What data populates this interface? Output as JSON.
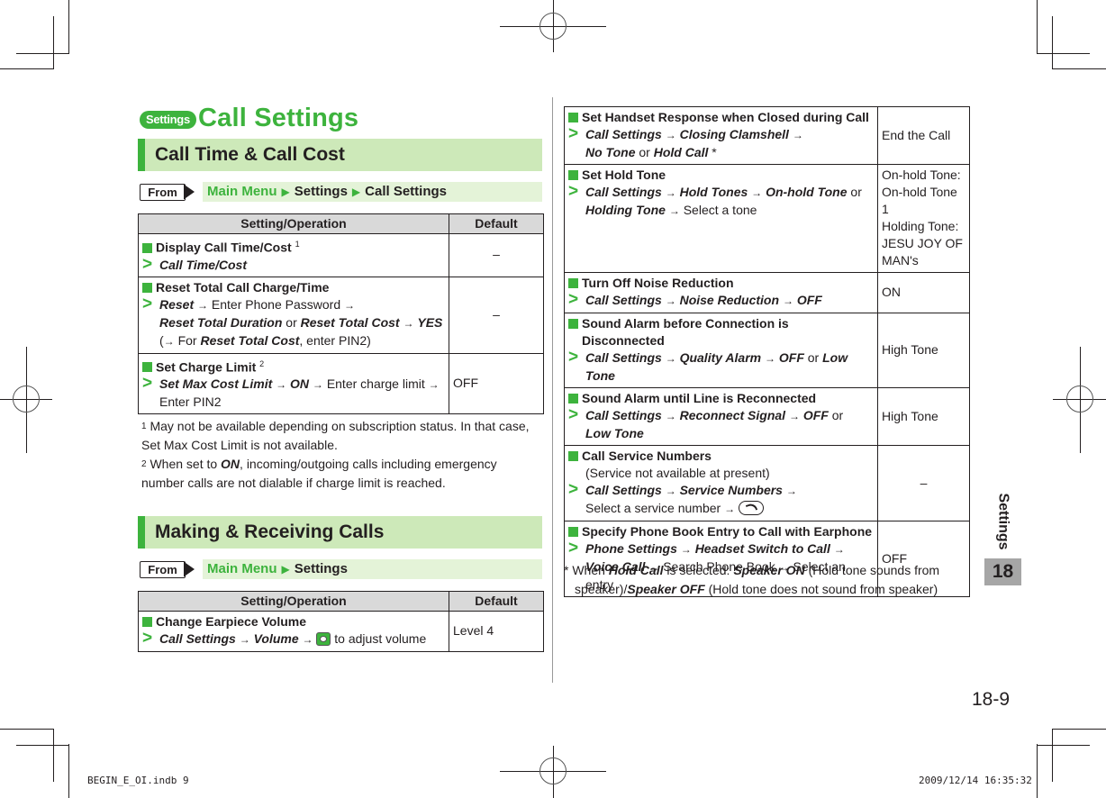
{
  "page": {
    "badge": "Settings",
    "title": "Call Settings",
    "side_label": "Settings",
    "chapter_number": "18",
    "page_number": "18-9",
    "slug_file": "BEGIN_E_OI.indb   9",
    "slug_timestamp": "2009/12/14   16:35:32"
  },
  "section1": {
    "heading": "Call Time & Call Cost",
    "from_label": "From",
    "breadcrumb": [
      "Main Menu",
      "Settings",
      "Call Settings"
    ],
    "table_headers": [
      "Setting/Operation",
      "Default"
    ],
    "rows": [
      {
        "title": "Display Call Time/Cost",
        "sup": "1",
        "op": "Call Time/Cost",
        "default": "–"
      },
      {
        "title": "Reset Total Call Charge/Time",
        "op1": "Reset",
        "op2": "Enter Phone Password",
        "op3": "Reset Total Duration",
        "or": "or",
        "op4": "Reset Total Cost",
        "op5": "YES",
        "note_pre": "(",
        "note_for": "For",
        "note_bi": "Reset Total Cost",
        "note_post": ", enter PIN2)",
        "default": "–"
      },
      {
        "title": "Set Charge Limit",
        "sup": "2",
        "op1": "Set Max Cost Limit",
        "op2": "ON",
        "op3": "Enter charge limit",
        "op4": "Enter PIN2",
        "default": "OFF"
      }
    ],
    "footnotes": [
      {
        "mark": "1",
        "text": "May not be available depending on subscription status. In that case, Set Max Cost Limit is not available."
      },
      {
        "mark": "2",
        "pre": "When set to",
        "bi": "ON",
        "post": ", incoming/outgoing calls including emergency number calls are not dialable if charge limit is reached."
      }
    ]
  },
  "section2": {
    "heading": "Making & Receiving Calls",
    "from_label": "From",
    "breadcrumb": [
      "Main Menu",
      "Settings"
    ],
    "table_headers": [
      "Setting/Operation",
      "Default"
    ],
    "rows": [
      {
        "title": "Change Earpiece Volume",
        "op1": "Call Settings",
        "op2": "Volume",
        "post": "to adjust volume",
        "default": "Level 4"
      }
    ]
  },
  "right_table": {
    "rows": [
      {
        "title": "Set Handset Response when Closed during Call",
        "op1": "Call Settings",
        "op2": "Closing Clamshell",
        "op3": "No Tone",
        "or": "or",
        "op4": "Hold Call",
        "star": "*",
        "default": "End the Call"
      },
      {
        "title": "Set Hold Tone",
        "op1": "Call Settings",
        "op2": "Hold Tones",
        "op3": "On-hold Tone",
        "or": "or",
        "op4": "Holding Tone",
        "post": "Select a tone",
        "default_lines": [
          "On-hold Tone:",
          "On-hold Tone 1",
          "Holding Tone:",
          "JESU JOY OF",
          "MAN's"
        ]
      },
      {
        "title": "Turn Off Noise Reduction",
        "op1": "Call Settings",
        "op2": "Noise Reduction",
        "op3": "OFF",
        "default": "ON"
      },
      {
        "title": "Sound Alarm before Connection is Disconnected",
        "op1": "Call Settings",
        "op2": "Quality Alarm",
        "op3": "OFF",
        "or": "or",
        "op4": "Low Tone",
        "default": "High Tone"
      },
      {
        "title": "Sound Alarm until Line is Reconnected",
        "op1": "Call Settings",
        "op2": "Reconnect Signal",
        "op3": "OFF",
        "or": "or",
        "op4": "Low Tone",
        "default": "High Tone"
      },
      {
        "title": "Call Service Numbers",
        "subtitle": "(Service not available at present)",
        "op1": "Call Settings",
        "op2": "Service Numbers",
        "post": "Select a service number",
        "default": "–"
      },
      {
        "title": "Specify Phone Book Entry to Call with Earphone",
        "op1": "Phone Settings",
        "op2": "Headset Switch to Call",
        "op3": "Voice Call",
        "post1": "Search Phone Book",
        "post2": "Select an entry",
        "default": "OFF"
      }
    ],
    "footnote": {
      "mark": "*",
      "pre": "When",
      "bi1": "Hold Call",
      "mid1": "is selected:",
      "bi2": "Speaker ON",
      "mid2": "(Hold tone sounds from speaker)/",
      "bi3": "Speaker OFF",
      "post": "(Hold tone does not sound from speaker)"
    }
  },
  "symbols": {
    "arrow": "→",
    "gt": ">",
    "triangle": "▶"
  }
}
